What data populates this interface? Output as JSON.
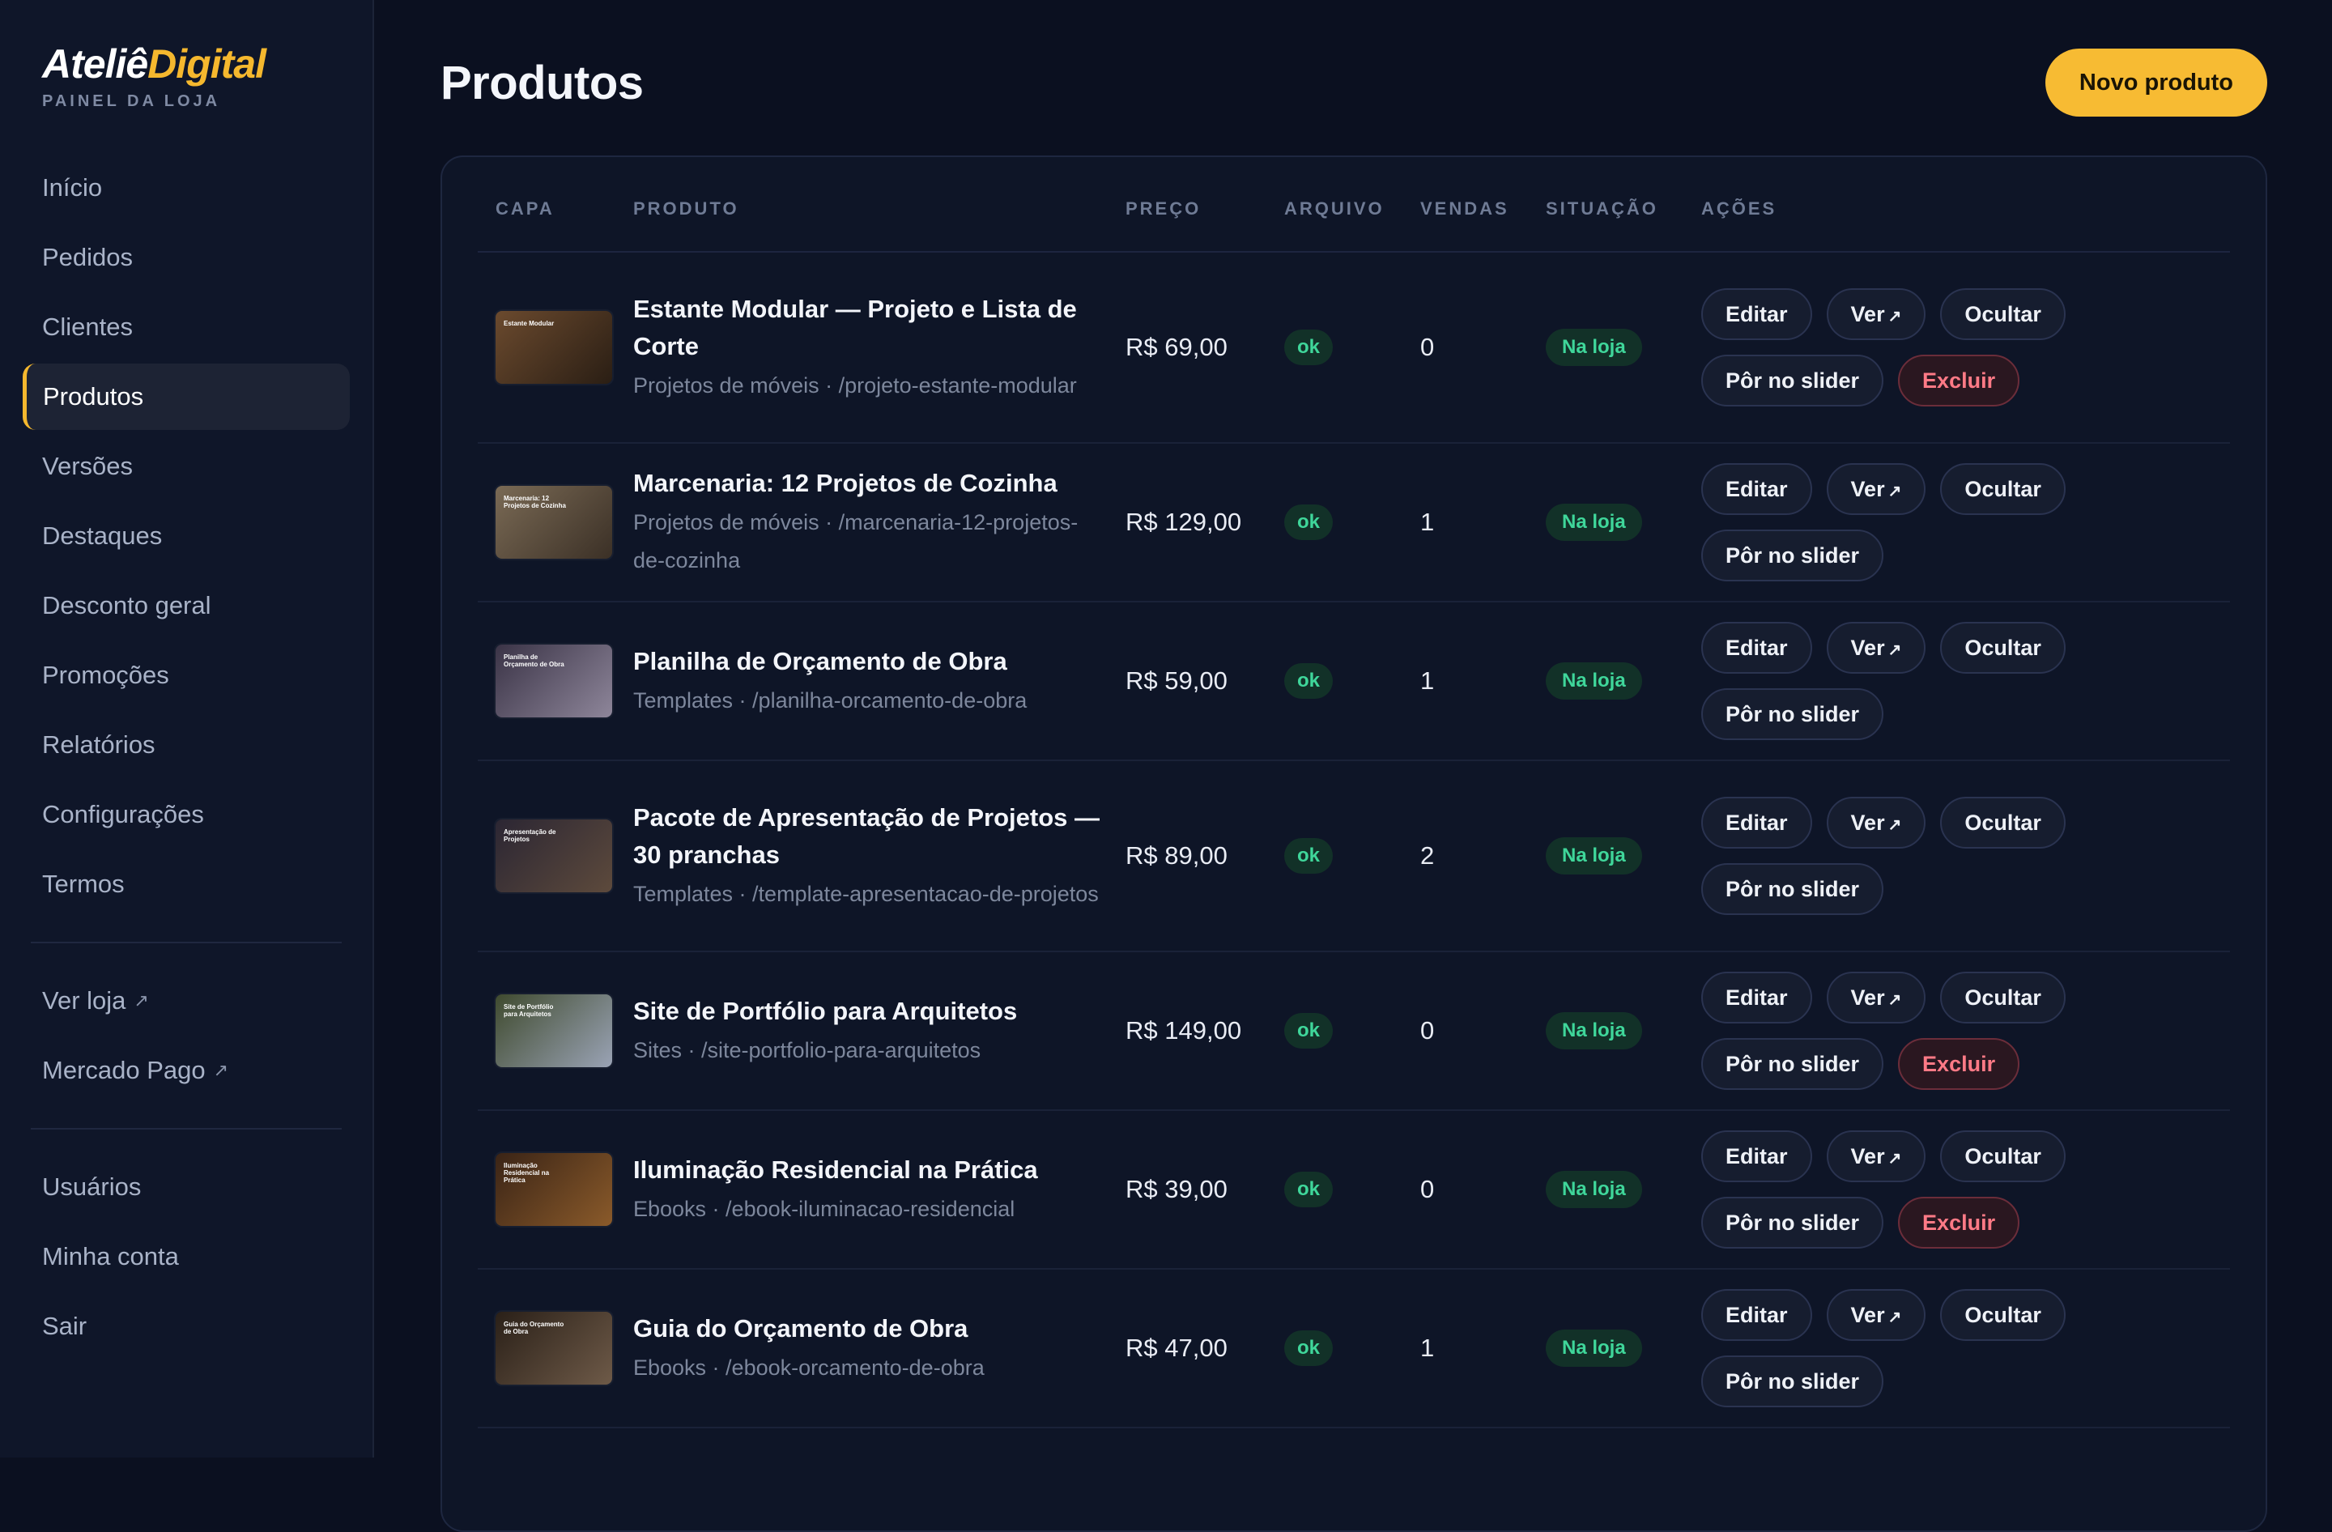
{
  "brand": {
    "part1": "Ateliê",
    "part2": "Digital",
    "subtitle": "PAINEL DA LOJA"
  },
  "nav": [
    {
      "label": "Início"
    },
    {
      "label": "Pedidos"
    },
    {
      "label": "Clientes"
    },
    {
      "label": "Produtos",
      "active": true
    },
    {
      "label": "Versões"
    },
    {
      "label": "Destaques"
    },
    {
      "label": "Desconto geral"
    },
    {
      "label": "Promoções"
    },
    {
      "label": "Relatórios"
    },
    {
      "label": "Configurações"
    },
    {
      "label": "Termos"
    }
  ],
  "nav_external": [
    {
      "label": "Ver loja",
      "icon": "↗"
    },
    {
      "label": "Mercado Pago",
      "icon": "↗"
    }
  ],
  "nav_account": [
    {
      "label": "Usuários"
    },
    {
      "label": "Minha conta"
    },
    {
      "label": "Sair"
    }
  ],
  "page": {
    "title": "Produtos",
    "new_button": "Novo produto"
  },
  "table": {
    "headers": {
      "capa": "CAPA",
      "produto": "PRODUTO",
      "preco": "PREÇO",
      "arquivo": "ARQUIVO",
      "vendas": "VENDAS",
      "situacao": "SITUAÇÃO",
      "acoes": "AÇÕES"
    },
    "button_labels": {
      "edit": "Editar",
      "view": "Ver",
      "view_icon": "↗",
      "hide": "Ocultar",
      "slider": "Pôr no slider",
      "delete": "Excluir"
    },
    "rows": [
      {
        "thumb_title": "Estante Modular",
        "name": "Estante Modular — Projeto e Lista de Corte",
        "meta": "Projetos de móveis · /projeto-estante-modular",
        "price": "R$ 69,00",
        "file": "ok",
        "sales": "0",
        "status": "Na loja",
        "can_delete": true,
        "thumb_colors": [
          "#6b4a2e",
          "#2a1e14"
        ]
      },
      {
        "thumb_title": "Marcenaria: 12 Projetos de Cozinha",
        "name": "Marcenaria: 12 Projetos de Cozinha",
        "meta": "Projetos de móveis · /marcenaria-12-projetos-de-cozinha",
        "price": "R$ 129,00",
        "file": "ok",
        "sales": "1",
        "status": "Na loja",
        "can_delete": false,
        "thumb_colors": [
          "#7a6a55",
          "#3b3026"
        ]
      },
      {
        "thumb_title": "Planilha de Orçamento de Obra",
        "name": "Planilha de Orçamento de Obra",
        "meta": "Templates · /planilha-orcamento-de-obra",
        "price": "R$ 59,00",
        "file": "ok",
        "sales": "1",
        "status": "Na loja",
        "can_delete": false,
        "thumb_colors": [
          "#3a3346",
          "#8e869a"
        ]
      },
      {
        "thumb_title": "Apresentação de Projetos",
        "name": "Pacote de Apresentação de Projetos — 30 pranchas",
        "meta": "Templates · /template-apresentacao-de-projetos",
        "price": "R$ 89,00",
        "file": "ok",
        "sales": "2",
        "status": "Na loja",
        "can_delete": false,
        "thumb_colors": [
          "#2b2633",
          "#5d4a3c"
        ]
      },
      {
        "thumb_title": "Site de Portfólio para Arquitetos",
        "name": "Site de Portfólio para Arquitetos",
        "meta": "Sites · /site-portfolio-para-arquitetos",
        "price": "R$ 149,00",
        "file": "ok",
        "sales": "0",
        "status": "Na loja",
        "can_delete": true,
        "thumb_colors": [
          "#3f4a2e",
          "#9aa3b5"
        ]
      },
      {
        "thumb_title": "Iluminação Residencial na Prática",
        "name": "Iluminação Residencial na Prática",
        "meta": "Ebooks · /ebook-iluminacao-residencial",
        "price": "R$ 39,00",
        "file": "ok",
        "sales": "0",
        "status": "Na loja",
        "can_delete": true,
        "thumb_colors": [
          "#3a2416",
          "#8a5a2a"
        ]
      },
      {
        "thumb_title": "Guia do Orçamento de Obra",
        "name": "Guia do Orçamento de Obra",
        "meta": "Ebooks · /ebook-orcamento-de-obra",
        "price": "R$ 47,00",
        "file": "ok",
        "sales": "1",
        "status": "Na loja",
        "can_delete": false,
        "thumb_colors": [
          "#2a2018",
          "#6e5a48"
        ]
      }
    ]
  }
}
